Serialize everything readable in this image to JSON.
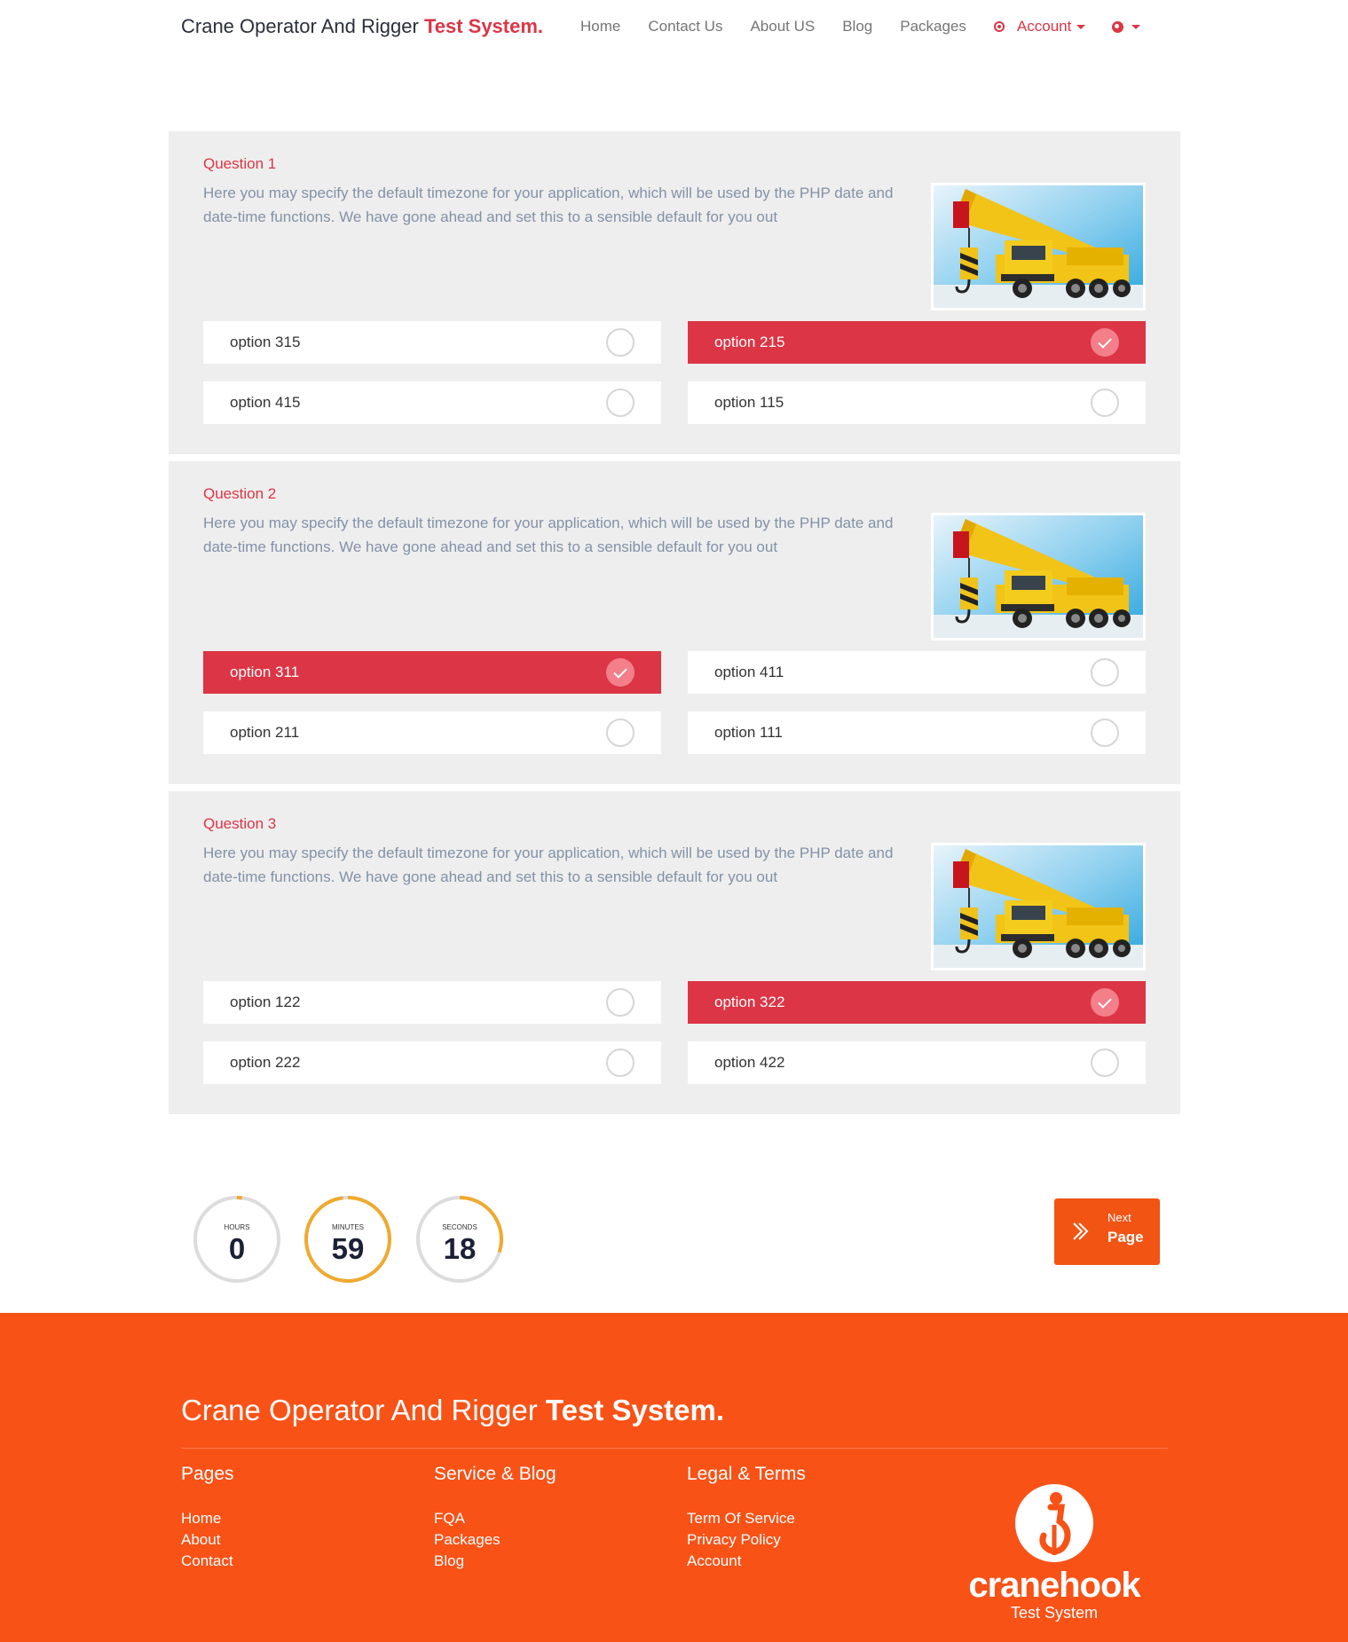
{
  "header": {
    "brand_regular": "Crane Operator And Rigger ",
    "brand_bold": "Test System.",
    "nav": [
      "Home",
      "Contact Us",
      "About US",
      "Blog",
      "Packages"
    ],
    "account_label": "Account"
  },
  "questions": [
    {
      "title": "Question 1",
      "text": "Here you may specify the default timezone for your application, which will be used by the PHP date and date-time functions. We have gone ahead and set this to a sensible default for you out",
      "options": [
        {
          "label": "option 315",
          "selected": false
        },
        {
          "label": "option 215",
          "selected": true
        },
        {
          "label": "option 415",
          "selected": false
        },
        {
          "label": "option 115",
          "selected": false
        }
      ]
    },
    {
      "title": "Question 2",
      "text": "Here you may specify the default timezone for your application, which will be used by the PHP date and date-time functions. We have gone ahead and set this to a sensible default for you out",
      "options": [
        {
          "label": "option 311",
          "selected": true
        },
        {
          "label": "option 411",
          "selected": false
        },
        {
          "label": "option 211",
          "selected": false
        },
        {
          "label": "option 111",
          "selected": false
        }
      ]
    },
    {
      "title": "Question 3",
      "text": "Here you may specify the default timezone for your application, which will be used by the PHP date and date-time functions. We have gone ahead and set this to a sensible default for you out",
      "options": [
        {
          "label": "option 122",
          "selected": false
        },
        {
          "label": "option 322",
          "selected": true
        },
        {
          "label": "option 222",
          "selected": false
        },
        {
          "label": "option 422",
          "selected": false
        }
      ]
    }
  ],
  "timer": {
    "hours": {
      "label": "HOURS",
      "value": "0",
      "progress": 0.02
    },
    "minutes": {
      "label": "MINUTES",
      "value": "59",
      "progress": 0.98
    },
    "seconds": {
      "label": "SECONDS",
      "value": "18",
      "progress": 0.3
    }
  },
  "next_button": {
    "line1": "Next",
    "line2": "Page"
  },
  "footer": {
    "brand_regular": "Crane Operator And Rigger ",
    "brand_bold": "Test System.",
    "columns": [
      {
        "heading": "Pages",
        "links": [
          "Home",
          "About",
          "Contact"
        ]
      },
      {
        "heading": "Service & Blog",
        "links": [
          "FQA",
          "Packages",
          "Blog"
        ]
      },
      {
        "heading": "Legal & Terms",
        "links": [
          "Term Of Service",
          "Privacy Policy",
          "Account"
        ]
      }
    ],
    "logo_wordmark": "cranehook",
    "logo_sub": "Test System"
  },
  "colors": {
    "accent": "#dc3545",
    "timer_arc": "#f0a92e",
    "timer_track": "#dcdcdc",
    "footer_bg": "#f85217",
    "next_button_bg": "#f25414"
  },
  "icons": [
    "account-icon",
    "globe-icon",
    "check-icon",
    "next-arrow-icon",
    "crane-hook-logo-icon"
  ]
}
